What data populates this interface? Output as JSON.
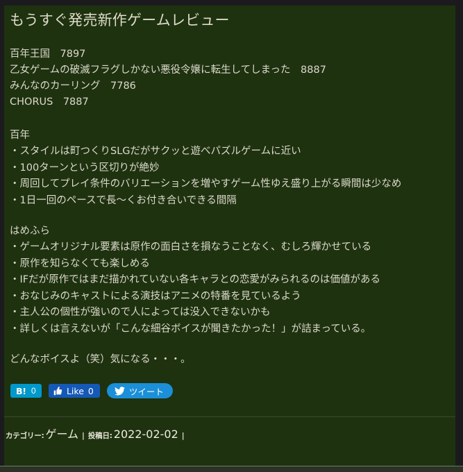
{
  "article": {
    "title": "もうすぐ発売新作ゲームレビュー",
    "intro_lines": [
      "百年王国　7897",
      "乙女ゲームの破滅フラグしかない悪役令嬢に転生してしまった　8887",
      "みんなのカーリング　7786",
      "CHORUS　7887"
    ],
    "sections": [
      {
        "heading": "百年",
        "bullets": [
          "スタイルは町つくりSLGだがサクッと遊べパズルゲームに近い",
          "100ターンという区切りが絶妙",
          "周回してプレイ条件のバリエーションを増やすゲーム性ゆえ盛り上がる瞬間は少なめ",
          "1日一回のペースで長〜くお付き合いできる間隔"
        ]
      },
      {
        "heading": "はめふら",
        "bullets": [
          "ゲームオリジナル要素は原作の面白さを損なうことなく、むしろ輝かせている",
          "原作を知らなくても楽しめる",
          "IFだが原作ではまだ描かれていない各キャラとの恋愛がみられるのは価値がある",
          "おなじみのキャストによる演技はアニメの特番を見ているよう",
          "主人公の個性が強いので人によっては没入できないかも",
          "詳しくは言えないが「こんな細谷ボイスが聞きたかった！」が詰まっている。"
        ]
      }
    ],
    "closing": "どんなボイスよ（笑）気になる・・・。"
  },
  "share": {
    "hatena": {
      "label": "B!",
      "count": "0",
      "icon": "hatena-bookmark-icon",
      "color": "#0099cb"
    },
    "facebook": {
      "label": "Like",
      "count": "0",
      "icon": "thumbs-up-icon",
      "color": "#1559b7"
    },
    "twitter": {
      "label": "ツイート",
      "icon": "twitter-bird-icon",
      "color": "#1b8fd8"
    }
  },
  "meta": {
    "category_label": "カテゴリー:",
    "category_value": "ゲーム",
    "pipe": "|",
    "date_label": "投稿日:",
    "date_value": "2022-02-02",
    "trailing_pipe": "|"
  },
  "colors": {
    "page_background": "#1b1b1d",
    "article_background": "#1e3210",
    "title_text": "#dfdac9",
    "body_text": "#ddd9cb"
  }
}
